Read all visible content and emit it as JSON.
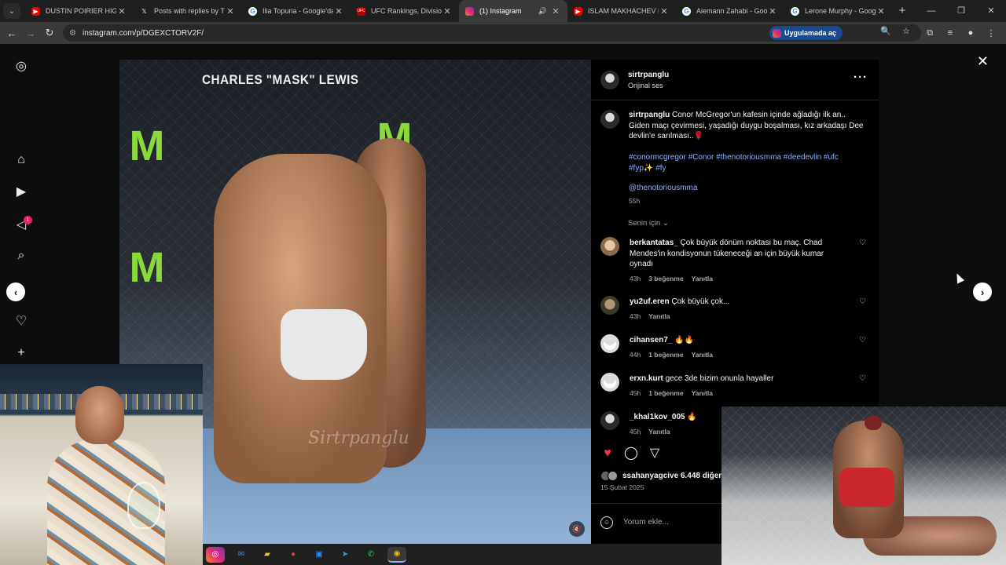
{
  "browser": {
    "tabs": [
      {
        "label": "DUSTIN POIRIER HIGHLIGHTS",
        "icon": "youtube-icon",
        "active": false
      },
      {
        "label": "Posts with replies by TheEff",
        "icon": "x-icon",
        "active": false
      },
      {
        "label": "Ilia Topuria - Google'da Ara",
        "icon": "google-icon",
        "active": false
      },
      {
        "label": "UFC Rankings, Division Rank",
        "icon": "ufc-icon",
        "active": false
      },
      {
        "label": "(1) Instagram",
        "icon": "instagram-icon",
        "active": true
      },
      {
        "label": "ISLAM MAKHACHEV HIÇ",
        "icon": "youtube-icon",
        "active": false
      },
      {
        "label": "Aiemann Zahabi - Google'da",
        "icon": "google-icon",
        "active": false
      },
      {
        "label": "Lerone Murphy - Google'da",
        "icon": "google-icon",
        "active": false
      }
    ],
    "url": "instagram.com/p/DGEXCTORV2F/",
    "open_app_label": "Uygulamada aç"
  },
  "post": {
    "username": "sirtrpanglu",
    "audio": "Orijinal ses",
    "caption_user": "sirtrpanglu",
    "caption": "Conor McGregor'un kafesin içinde ağladığı ilk an.. Giden maçı çevirmesi, yaşadığı duygu boşalması, kız arkadaşı Dee devlin'e sarılması..🌹",
    "hashtags": "#conormcgregor #Conor #thenotoriousmma #deedevlin #ufc #fyp✨ #fy",
    "mention": "@thenotoriousmma",
    "caption_time": "55h",
    "for_you": "Senin için ⌄",
    "likes_user": "ssahanyagci",
    "likes_text": " ve 6.448 diğer",
    "date": "15 Şubat 2025",
    "comment_placeholder": "Yorum ekle...",
    "video_title": "CHARLES \"MASK\" LEWIS",
    "video_watermark": "Sirtrpanglu"
  },
  "comments": [
    {
      "user": "berkantatas_",
      "text": " Çok büyük dönüm noktası bu maç. Chad Mendes'in kondisyonun tükeneceği an için büyük kumar oynadı",
      "time": "43h",
      "likes": "3 beğenme",
      "reply": "Yanıtla"
    },
    {
      "user": "yu2uf.eren",
      "text": " Çok büyük çok...",
      "time": "43h",
      "likes": "",
      "reply": "Yanıtla"
    },
    {
      "user": "cihansen7_",
      "text": " 🔥🔥",
      "time": "44h",
      "likes": "1 beğenme",
      "reply": "Yanıtla"
    },
    {
      "user": "erxn.kurt",
      "text": " gece 3de bizim onunla hayaller",
      "time": "45h",
      "likes": "1 beğenme",
      "reply": "Yanıtla"
    },
    {
      "user": "_khal1kov_005",
      "text": " 🔥",
      "time": "45h",
      "likes": "",
      "reply": "Yanıtla"
    }
  ],
  "sidebar": {
    "badge": "1"
  },
  "icons": {
    "instagram": "instagram-icon",
    "home": "home-icon",
    "reels": "reels-icon",
    "explore": "explore-icon",
    "search": "search-icon",
    "heart": "heart-icon",
    "create": "plus-icon"
  },
  "colors": {
    "link": "#8ab4f8",
    "like_red": "#ff3040",
    "badge": "#e0245e"
  }
}
